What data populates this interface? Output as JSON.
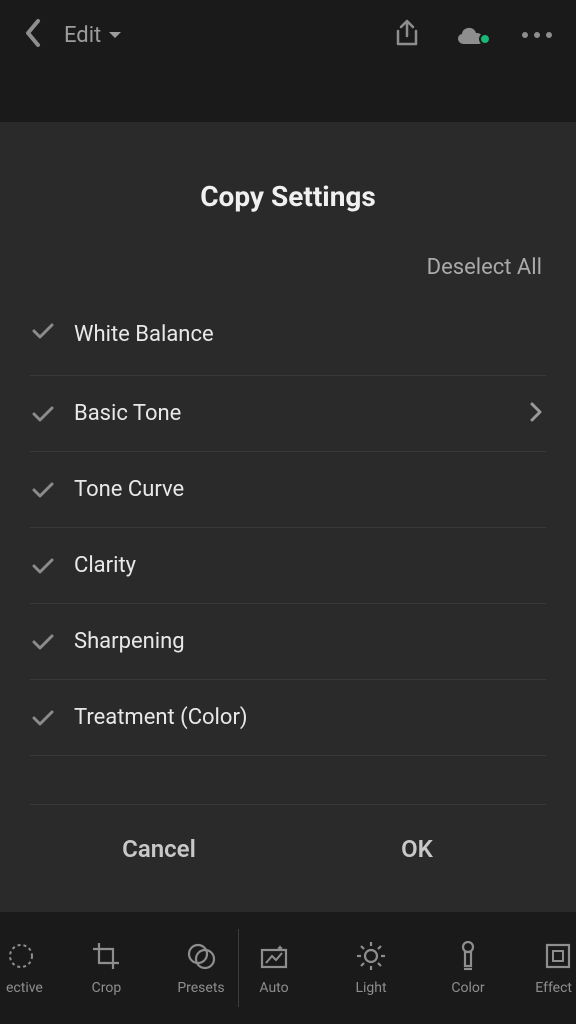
{
  "header": {
    "edit_label": "Edit"
  },
  "dialog": {
    "title": "Copy Settings",
    "deselect_all": "Deselect All",
    "items": [
      {
        "label": "White Balance",
        "checked": true,
        "has_detail": false
      },
      {
        "label": "Basic Tone",
        "checked": true,
        "has_detail": true
      },
      {
        "label": "Tone Curve",
        "checked": true,
        "has_detail": false
      },
      {
        "label": "Clarity",
        "checked": true,
        "has_detail": false
      },
      {
        "label": "Sharpening",
        "checked": true,
        "has_detail": false
      },
      {
        "label": "Treatment (Color)",
        "checked": true,
        "has_detail": false
      }
    ],
    "actions": {
      "cancel": "Cancel",
      "ok": "OK"
    }
  },
  "toolbar": {
    "items": [
      {
        "label": "ective",
        "name": "selective"
      },
      {
        "label": "Crop",
        "name": "crop"
      },
      {
        "label": "Presets",
        "name": "presets"
      },
      {
        "label": "Auto",
        "name": "auto"
      },
      {
        "label": "Light",
        "name": "light"
      },
      {
        "label": "Color",
        "name": "color"
      },
      {
        "label": "Effect",
        "name": "effects"
      }
    ]
  }
}
